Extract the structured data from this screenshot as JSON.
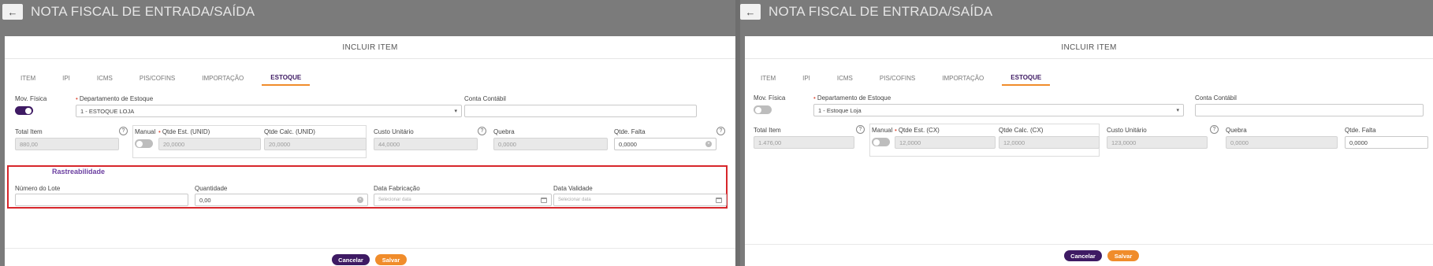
{
  "page_title": "NOTA FISCAL DE ENTRADA/SAÍDA",
  "modal_title": "INCLUIR ITEM",
  "tabs": [
    "ITEM",
    "IPI",
    "ICMS",
    "PIS/COFINS",
    "IMPORTAÇÃO",
    "ESTOQUE"
  ],
  "active_tab": "ESTOQUE",
  "icons": {
    "back": "←",
    "help": "?",
    "caret": "▾",
    "clear": "×"
  },
  "colors": {
    "primary": "#3e1a63",
    "accent": "#f08c2b",
    "highlight_border": "#d7262b",
    "section_title": "#6b3fa0"
  },
  "labels": {
    "mov_fisica": "Mov. Física",
    "departamento": "Departamento de Estoque",
    "conta_contabil": "Conta Contábil",
    "total_item": "Total Item",
    "manual": "Manual",
    "custo_unitario": "Custo Unitário",
    "quebra": "Quebra",
    "qtde_falta": "Qtde. Falta"
  },
  "left": {
    "mov_fisica_on": true,
    "departamento_value": "1 - ESTOQUE LOJA",
    "conta_contabil_value": "",
    "total_item_value": "880,00",
    "manual_on": false,
    "qtde_est_label": "Qtde Est. (UNID)",
    "qtde_est_value": "20,0000",
    "qtde_calc_label": "Qtde Calc. (UNID)",
    "qtde_calc_value": "20,0000",
    "custo_unitario_value": "44,0000",
    "quebra_value": "0,0000",
    "qtde_falta_value": "0,0000",
    "rastreabilidade": {
      "title": "Rastreabilidade",
      "numero_lote_label": "Número do Lote",
      "numero_lote_value": "",
      "quantidade_label": "Quantidade",
      "quantidade_value": "0,00",
      "data_fabricacao_label": "Data Fabricação",
      "data_fabricacao_placeholder": "Selecionar data",
      "data_validade_label": "Data Validade",
      "data_validade_placeholder": "Selecionar data"
    },
    "cancel_label": "Cancelar",
    "save_label": "Salvar"
  },
  "right": {
    "mov_fisica_on": false,
    "departamento_value": "1 - Estoque Loja",
    "conta_contabil_value": "",
    "total_item_value": "1.476,00",
    "manual_on": false,
    "qtde_est_label": "Qtde Est. (CX)",
    "qtde_est_value": "12,0000",
    "qtde_calc_label": "Qtde Calc. (CX)",
    "qtde_calc_value": "12,0000",
    "custo_unitario_value": "123,0000",
    "quebra_value": "0,0000",
    "qtde_falta_value": "0,0000",
    "cancel_label": "Cancelar",
    "save_label": "Salvar"
  }
}
